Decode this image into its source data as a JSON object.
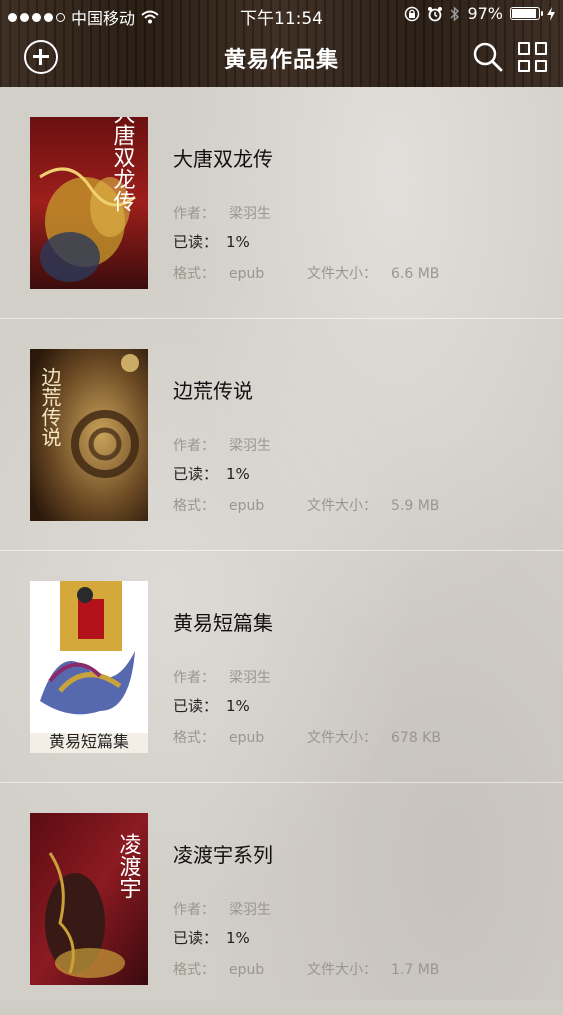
{
  "status_bar": {
    "carrier": "中国移动",
    "time": "下午11:54",
    "battery": "97%",
    "battery_level": 0.97
  },
  "nav": {
    "title": "黄易作品集"
  },
  "labels": {
    "author": "作者：",
    "read": "已读：",
    "format": "格式：",
    "size": "文件大小："
  },
  "books": [
    {
      "title": "大唐双龙传",
      "author": "梁羽生",
      "read": "1%",
      "format": "epub",
      "size": "6.6 MB",
      "cover_text": "大唐双龙传",
      "colors": [
        "#8e1b1b",
        "#c79d2c",
        "#2c3a5a"
      ]
    },
    {
      "title": "边荒传说",
      "author": "梁羽生",
      "read": "1%",
      "format": "epub",
      "size": "5.9 MB",
      "cover_text": "边荒传说",
      "colors": [
        "#6b4a24",
        "#c9a25a",
        "#3b2412"
      ]
    },
    {
      "title": "黄易短篇集",
      "author": "梁羽生",
      "read": "1%",
      "format": "epub",
      "size": "678 KB",
      "cover_text": "黄易短篇集",
      "colors": [
        "#ffffff",
        "#c8a23a",
        "#3a4fa0"
      ]
    },
    {
      "title": "凌渡宇系列",
      "author": "梁羽生",
      "read": "1%",
      "format": "epub",
      "size": "1.7 MB",
      "cover_text": "凌渡宇",
      "colors": [
        "#8c1a22",
        "#c9a03a",
        "#2a1a14"
      ]
    }
  ]
}
